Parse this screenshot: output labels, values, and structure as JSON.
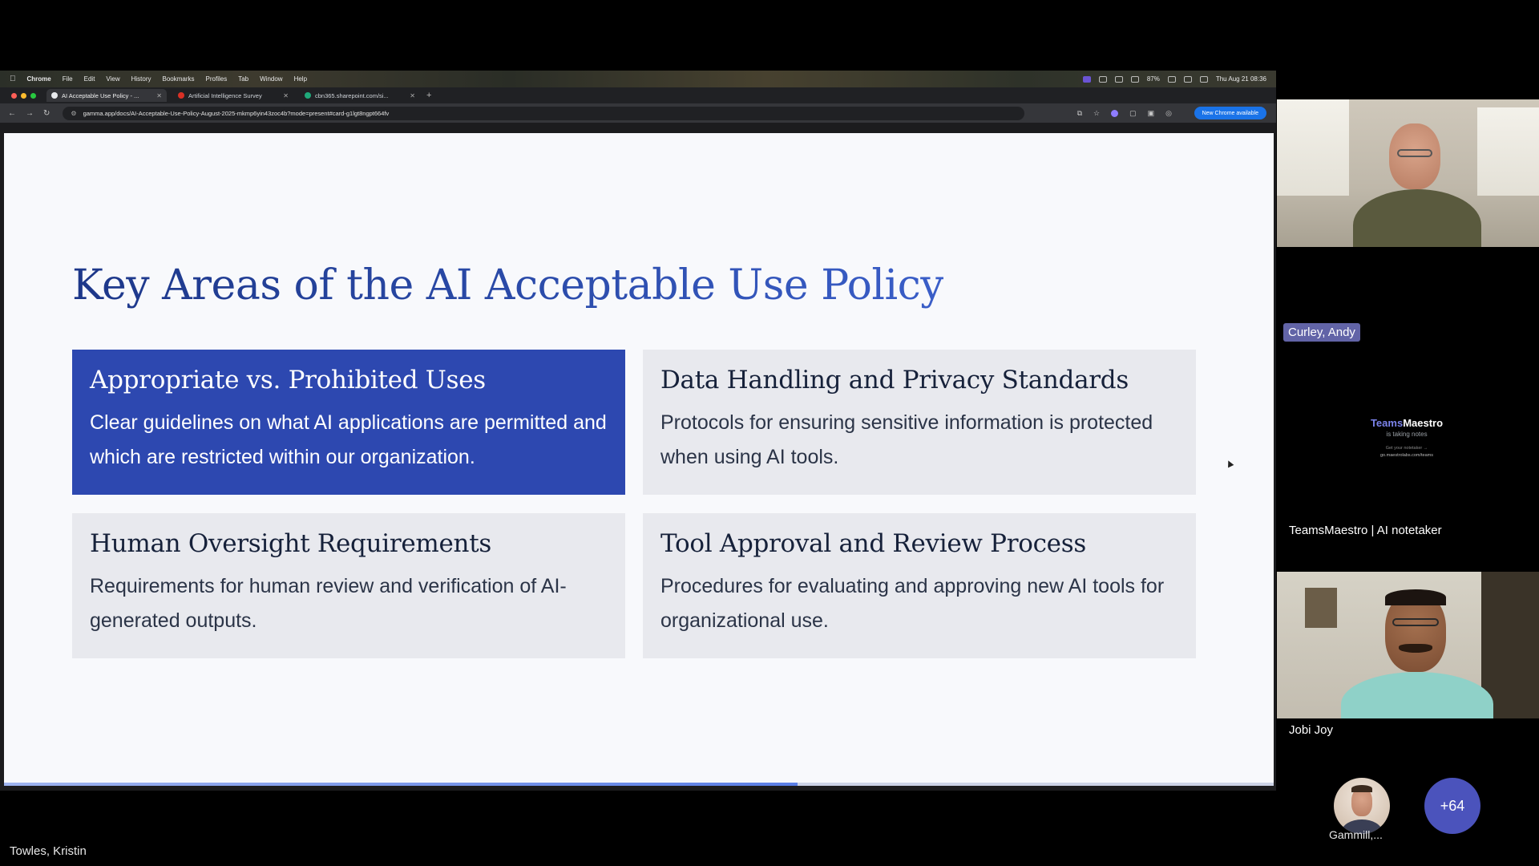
{
  "menubar": {
    "app": "Chrome",
    "items": [
      "File",
      "Edit",
      "View",
      "History",
      "Bookmarks",
      "Profiles",
      "Tab",
      "Window",
      "Help"
    ],
    "clock": "Thu Aug 21 08:36",
    "battery": "87%"
  },
  "browser": {
    "tabs": [
      {
        "label": "AI Acceptable Use Policy - ...",
        "favicon_color": "#e8eaed"
      },
      {
        "label": "Artificial Intelligence Survey",
        "favicon_color": "#d93025"
      },
      {
        "label": "cbn365.sharepoint.com/si...",
        "favicon_color": "#1fa97a"
      }
    ],
    "url": "gamma.app/docs/AI-Acceptable-Use-Policy-August-2025-mkmp6yin43zoc4b?mode=present#card-g1lgt8ngpt664fv",
    "update_label": "New Chrome available"
  },
  "slide": {
    "title": "Key Areas of the AI Acceptable Use Policy",
    "cards": [
      {
        "heading": "Appropriate vs. Prohibited Uses",
        "body": "Clear guidelines on what AI applications are permitted and which are restricted within our organization."
      },
      {
        "heading": "Data Handling and Privacy Standards",
        "body": "Protocols for ensuring sensitive information is protected when using AI tools."
      },
      {
        "heading": "Human Oversight Requirements",
        "body": "Requirements for human review and verification of AI-generated outputs."
      },
      {
        "heading": "Tool Approval and Review Process",
        "body": "Procedures for evaluating and approving new AI tools for organizational use."
      }
    ],
    "progress": 0.625
  },
  "meeting": {
    "presenter": "Towles, Kristin",
    "participants": {
      "andy": "Curley, Andy",
      "maestro": "TeamsMaestro | AI notetaker",
      "jobi": "Jobi Joy",
      "gammill": "Gammill,..."
    },
    "maestro_tile": {
      "brand_a": "Teams",
      "brand_b": "Maestro",
      "subtitle": "is taking notes",
      "line1": "Get your notetaker →",
      "line2": "go.maestrolabs.com/teams"
    },
    "more_count": "+64"
  }
}
